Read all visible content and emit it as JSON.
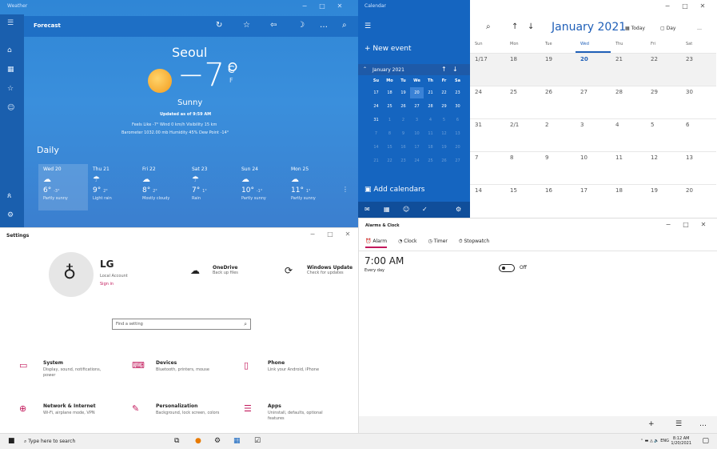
{
  "weather": {
    "window_title": "Weather",
    "toolbar_label": "Forecast",
    "city": "Seoul",
    "temp": "−7°",
    "unit_c": "C",
    "unit_f": "F",
    "condition": "Sunny",
    "updated": "Updated as of 9:59 AM",
    "details_line1": "Feels Like  -7°    Wind  0 km/h    Visibility  15 km",
    "details_line2": "Barometer  1032.00 mb    Humidity  45%    Dew Point  -14°",
    "daily_label": "Daily",
    "days": [
      {
        "name": "Wed 20",
        "temp": "6°",
        "low": "-3°",
        "cond": "Partly sunny"
      },
      {
        "name": "Thu 21",
        "temp": "9°",
        "low": "2°",
        "cond": "Light rain"
      },
      {
        "name": "Fri 22",
        "temp": "8°",
        "low": "2°",
        "cond": "Mostly cloudy"
      },
      {
        "name": "Sat 23",
        "temp": "7°",
        "low": "1°",
        "cond": "Rain"
      },
      {
        "name": "Sun 24",
        "temp": "10°",
        "low": "-1°",
        "cond": "Partly sunny"
      },
      {
        "name": "Mon 25",
        "temp": "11°",
        "low": "1°",
        "cond": "Partly sunny"
      }
    ]
  },
  "calendar": {
    "window_title": "Calendar",
    "new_event": "+   New event",
    "mini_month": "January 2021",
    "weekdays_short": [
      "Su",
      "Mo",
      "Tu",
      "We",
      "Th",
      "Fr",
      "Sa"
    ],
    "mini_days": [
      "17",
      "18",
      "19",
      "20",
      "21",
      "22",
      "23",
      "24",
      "25",
      "26",
      "27",
      "28",
      "29",
      "30",
      "31",
      "1",
      "2",
      "3",
      "4",
      "5",
      "6",
      "7",
      "8",
      "9",
      "10",
      "11",
      "12",
      "13",
      "14",
      "15",
      "16",
      "17",
      "18",
      "19",
      "20",
      "21",
      "22",
      "23",
      "24",
      "25",
      "26",
      "27"
    ],
    "add_calendars": "Add calendars",
    "month_title": "January 2021",
    "today_btn": "Today",
    "day_btn": "Day",
    "weekdays": [
      "Sun",
      "Mon",
      "Tue",
      "Wed",
      "Thu",
      "Fri",
      "Sat"
    ],
    "weeks": [
      [
        "1/17",
        "18",
        "19",
        "20",
        "21",
        "22",
        "23"
      ],
      [
        "24",
        "25",
        "26",
        "27",
        "28",
        "29",
        "30"
      ],
      [
        "31",
        "2/1",
        "2",
        "3",
        "4",
        "5",
        "6"
      ],
      [
        "7",
        "8",
        "9",
        "10",
        "11",
        "12",
        "13"
      ],
      [
        "14",
        "15",
        "16",
        "17",
        "18",
        "19",
        "20"
      ]
    ]
  },
  "settings": {
    "window_title": "Settings",
    "user_name": "LG",
    "account_type": "Local Account",
    "sign_in": "Sign in",
    "onedrive_title": "OneDrive",
    "onedrive_sub": "Back up files",
    "update_title": "Windows Update",
    "update_sub": "Check for updates",
    "search_placeholder": "Find a setting",
    "categories": [
      {
        "title": "System",
        "sub": "Display, sound, notifications, power"
      },
      {
        "title": "Devices",
        "sub": "Bluetooth, printers, mouse"
      },
      {
        "title": "Phone",
        "sub": "Link your Android, iPhone"
      },
      {
        "title": "Network & Internet",
        "sub": "Wi-Fi, airplane mode, VPN"
      },
      {
        "title": "Personalization",
        "sub": "Background, lock screen, colors"
      },
      {
        "title": "Apps",
        "sub": "Uninstall, defaults, optional features"
      }
    ]
  },
  "alarms": {
    "window_title": "Alarms & Clock",
    "tabs": [
      "Alarm",
      "Clock",
      "Timer",
      "Stopwatch"
    ],
    "alarm_time": "7:00 AM",
    "alarm_repeat": "Every day",
    "alarm_state": "Off"
  },
  "taskbar": {
    "search_placeholder": "Type here to search",
    "lang": "ENG",
    "time": "8:12 AM",
    "date": "1/20/2021"
  },
  "colors": {
    "weather_bg": "#3a8fdc",
    "calendar_accent": "#1565c0",
    "settings_accent": "#c2185b"
  }
}
